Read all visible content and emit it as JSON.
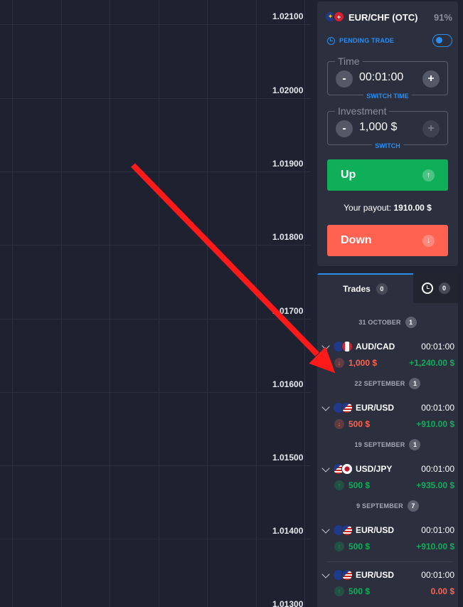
{
  "chart": {
    "prices": [
      "1.02100",
      "1.02000",
      "1.01900",
      "1.01800",
      "1.01700",
      "1.01600",
      "1.01500",
      "1.01400",
      "1.01300"
    ]
  },
  "asset": {
    "name": "EUR/CHF (OTC)",
    "payout_pct": "91%",
    "flag_icons": [
      "eu-flag-icon",
      "swiss-flag-icon"
    ]
  },
  "pending": {
    "label": "PENDING TRADE",
    "icon": "clock-icon",
    "enabled": true
  },
  "time_field": {
    "label": "Time",
    "value": "00:01:00",
    "minus": "-",
    "plus": "+",
    "switch_label": "SWITCH TIME"
  },
  "investment_field": {
    "label": "Investment",
    "value": "1,000 $",
    "minus": "-",
    "plus": "+",
    "switch_label": "SWITCH"
  },
  "up_button": {
    "label": "Up",
    "icon": "arrow-up-icon",
    "color": "#0faf59"
  },
  "payout": {
    "label": "Your payout:",
    "value": "1910.00 $"
  },
  "down_button": {
    "label": "Down",
    "icon": "arrow-down-icon",
    "color": "#ff6251"
  },
  "tabs": {
    "trades_label": "Trades",
    "trades_count": "0",
    "history_icon": "clock-icon",
    "history_count": "0"
  },
  "groups": [
    {
      "date": "31 OCTOBER",
      "count": "1",
      "trades": [
        {
          "pair": "AUD/CAD",
          "duration": "00:01:00",
          "direction": "down",
          "amount": "1,000 $",
          "profit": "+1,240.00 $",
          "flags": [
            "fl-au",
            "fl-ca"
          ]
        }
      ]
    },
    {
      "date": "22 SEPTEMBER",
      "count": "1",
      "trades": [
        {
          "pair": "EUR/USD",
          "duration": "00:01:00",
          "direction": "down",
          "amount": "500 $",
          "profit": "+910.00 $",
          "flags": [
            "fl-eu",
            "fl-us-c"
          ]
        }
      ]
    },
    {
      "date": "19 SEPTEMBER",
      "count": "1",
      "trades": [
        {
          "pair": "USD/JPY",
          "duration": "00:01:00",
          "direction": "up",
          "amount": "500 $",
          "profit": "+935.00 $",
          "flags": [
            "fl-us-c",
            "fl-jp"
          ]
        }
      ]
    },
    {
      "date": "9 SEPTEMBER",
      "count": "7",
      "trades": [
        {
          "pair": "EUR/USD",
          "duration": "00:01:00",
          "direction": "up",
          "amount": "500 $",
          "profit": "+910.00 $",
          "flags": [
            "fl-eu",
            "fl-us-c"
          ]
        },
        {
          "pair": "EUR/USD",
          "duration": "00:01:00",
          "direction": "up",
          "amount": "500 $",
          "profit": "0.00 $",
          "flags": [
            "fl-eu",
            "fl-us-c"
          ]
        }
      ]
    }
  ],
  "annotation": {
    "icon": "red-arrow-annotation-icon",
    "color": "#ff1a1a"
  }
}
